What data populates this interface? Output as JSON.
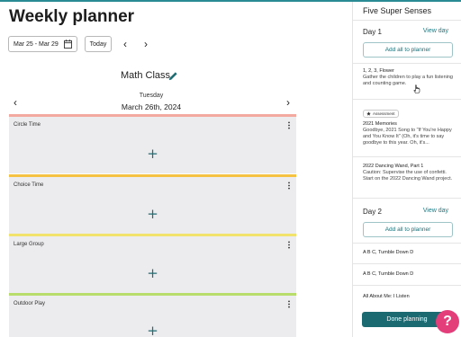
{
  "page": {
    "title": "Weekly planner"
  },
  "toolbar": {
    "date_range": "Mar 25 - Mar 29",
    "today_label": "Today",
    "calendar_icon": "calendar-icon",
    "prev_icon": "chevron-left-icon",
    "next_icon": "chevron-right-icon"
  },
  "planner": {
    "class_name": "Math Class",
    "edit_icon": "pencil-icon",
    "day_name": "Tuesday",
    "day_date": "March 26th, 2024",
    "slots": [
      {
        "label": "Circle Time",
        "color": "#f4a9a0"
      },
      {
        "label": "Choice Time",
        "color": "#f5c242"
      },
      {
        "label": "Large Group",
        "color": "#f1e36b"
      },
      {
        "label": "Outdoor Play",
        "color": "#b9dd6a"
      }
    ],
    "add_symbol": "+"
  },
  "panel": {
    "title": "Five Super Senses",
    "day1": {
      "label": "Day 1",
      "view_day": "View day",
      "add_all": "Add all to planner",
      "activities": [
        {
          "title": "1, 2, 3, Flower",
          "desc": "Gather the children to play a fun listening and counting game."
        },
        {
          "badge": "Assessment",
          "title": "2021 Memories",
          "desc": "Goodbye, 2021 Song to \"If You're Happy and You Know It\" (Oh, it's time to say goodbye to this year. Oh, it's..."
        },
        {
          "title": "2022 Dancing Wand, Part 1",
          "desc": "Caution: Supervise the use of confetti. Start on the 2022 Dancing Wand project."
        }
      ]
    },
    "day2": {
      "label": "Day 2",
      "view_day": "View day",
      "add_all": "Add all to planner",
      "activities": [
        {
          "title": "A B C, Tumble Down D"
        },
        {
          "title": "A B C, Tumble Down D"
        },
        {
          "title": "All About Me: I Listen"
        }
      ]
    },
    "done_label": "Done planning"
  },
  "help": {
    "label": "?"
  },
  "colors": {
    "accent": "#1b6a72",
    "link": "#1c7c86",
    "help": "#e33e7a",
    "slot_bg": "#ececee"
  }
}
